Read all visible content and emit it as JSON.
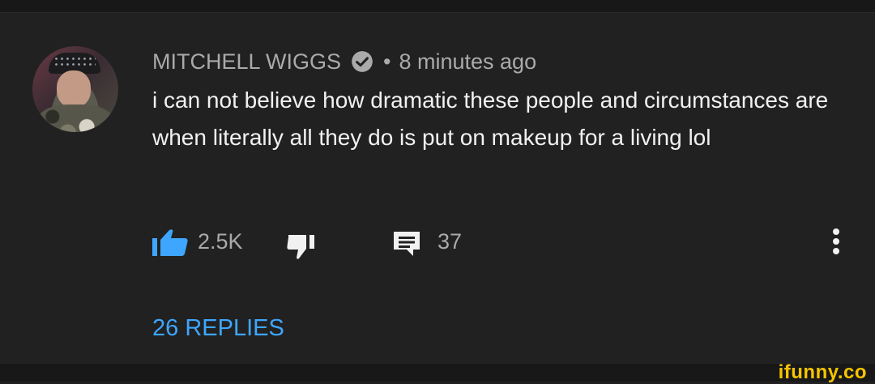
{
  "comment": {
    "author": "MITCHELL WIGGS",
    "separator": "•",
    "timestamp": "8 minutes ago",
    "text": "i can not believe how dramatic these people and circumstances are when literally all they do is put on makeup for a living lol",
    "like_count": "2.5K",
    "reply_count": "37",
    "replies_link": "26 REPLIES",
    "verified": true
  },
  "watermark": "ifunny.co",
  "colors": {
    "background": "#212121",
    "accent": "#3ea6ff",
    "text_primary": "#f1f1f1",
    "text_secondary": "#aaaaaa",
    "watermark": "#f5c400"
  },
  "icons": {
    "like": "thumbs-up-icon",
    "dislike": "thumbs-down-icon",
    "reply": "comment-icon",
    "more": "more-vertical-icon",
    "verified": "verified-check-icon"
  }
}
